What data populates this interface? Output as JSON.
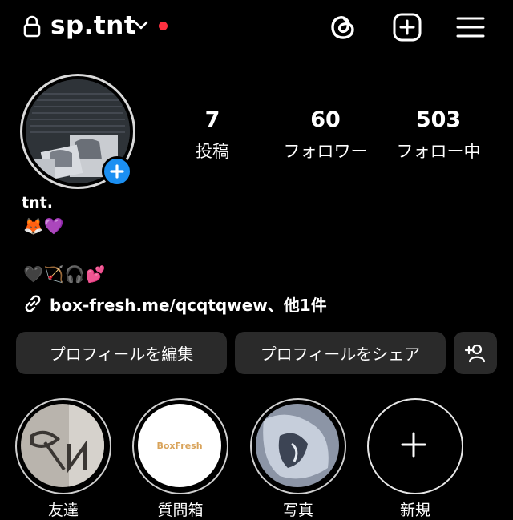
{
  "header": {
    "username": "sp.tnt",
    "icons": [
      "lock-icon",
      "chevron-down-icon",
      "threads-icon",
      "new-post-icon",
      "menu-icon"
    ],
    "notification_dot_color": "#ff3040"
  },
  "profile": {
    "avatar_badge_color": "#1b8ff2",
    "stats": [
      {
        "value": "7",
        "label": "投稿"
      },
      {
        "value": "60",
        "label": "フォロワー"
      },
      {
        "value": "503",
        "label": "フォロー中"
      }
    ],
    "display_name": "tnt.",
    "bio_line1": "🦊💜",
    "bio_line2": "🖤🏹🎧💕",
    "link_text": "box-fresh.me/qcqtqwew、他1件"
  },
  "actions": {
    "edit_profile": "プロフィールを編集",
    "share_profile": "プロフィールをシェア",
    "add_user_icon": "add-person-icon"
  },
  "highlights": [
    {
      "label": "友達"
    },
    {
      "label": "質問箱",
      "thumb_text": "BoxFresh"
    },
    {
      "label": "写真"
    },
    {
      "label": "新規"
    }
  ]
}
